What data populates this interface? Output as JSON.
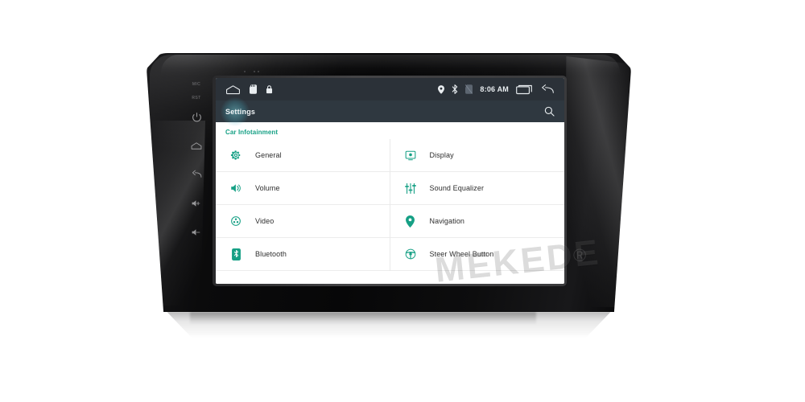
{
  "device": {
    "brand_watermark": "MEKEDE",
    "registered_mark": "®",
    "hard_keys": [
      {
        "name": "mic-label",
        "label": "MIC",
        "type": "label"
      },
      {
        "name": "reset-label",
        "label": "RST",
        "type": "label"
      },
      {
        "name": "power-key",
        "label": "Power",
        "icon": "power-icon"
      },
      {
        "name": "home-key",
        "label": "Home",
        "icon": "home-icon"
      },
      {
        "name": "back-key",
        "label": "Back",
        "icon": "back-arrow-icon"
      },
      {
        "name": "volume-up-key",
        "label": "Volume Up",
        "icon": "volume-up-icon"
      },
      {
        "name": "volume-down-key",
        "label": "Volume Down",
        "icon": "volume-down-icon"
      }
    ]
  },
  "statusbar": {
    "time": "8:06 AM",
    "left_icons": [
      {
        "name": "home-icon",
        "label": "Home"
      },
      {
        "name": "sd-card-icon",
        "label": "SD Card"
      },
      {
        "name": "lock-icon",
        "label": "Lock"
      }
    ],
    "right_icons": [
      {
        "name": "location-pin-icon",
        "label": "Location"
      },
      {
        "name": "bluetooth-icon",
        "label": "Bluetooth"
      },
      {
        "name": "sd-card-off-icon",
        "label": "SD Card Disabled"
      }
    ],
    "nav_icons": [
      {
        "name": "recents-icon",
        "label": "Recent Apps"
      },
      {
        "name": "back-arrow-icon",
        "label": "Back"
      }
    ]
  },
  "actionbar": {
    "title": "Settings",
    "search_icon": "search-icon"
  },
  "main": {
    "section_title": "Car Infotainment",
    "columns": [
      {
        "side": "left",
        "items": [
          {
            "icon": "gear-icon",
            "label": "General"
          },
          {
            "icon": "volume-icon",
            "label": "Volume"
          },
          {
            "icon": "video-icon",
            "label": "Video"
          },
          {
            "icon": "bluetooth-icon",
            "label": "Bluetooth"
          }
        ]
      },
      {
        "side": "right",
        "items": [
          {
            "icon": "display-icon",
            "label": "Display"
          },
          {
            "icon": "equalizer-icon",
            "label": "Sound Equalizer"
          },
          {
            "icon": "navigation-pin-icon",
            "label": "Navigation"
          },
          {
            "icon": "steering-wheel-icon",
            "label": "Steer Wheel Button"
          }
        ]
      }
    ]
  },
  "colors": {
    "accent_teal": "#16a085",
    "statusbar_bg": "#2b3138",
    "actionbar_bg": "#2f3840",
    "content_bg": "#ffffff",
    "text_primary": "#2d2d2d",
    "status_text": "#e9edf0",
    "ripple": "#78dce6"
  }
}
